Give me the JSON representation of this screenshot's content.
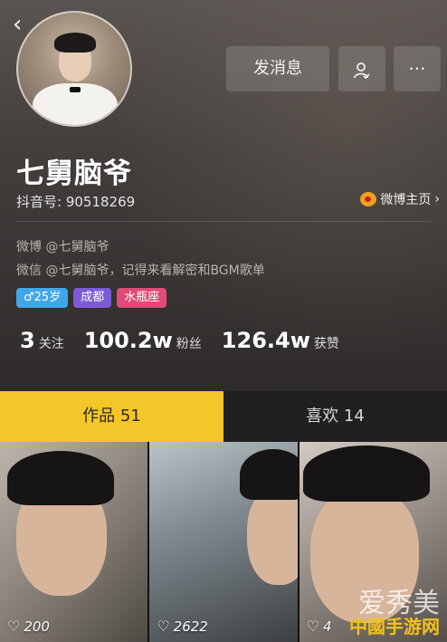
{
  "header": {
    "back_icon": "back-chevron-icon",
    "send_message_label": "发消息",
    "follow_icon": "user-check-icon",
    "more_icon": "more-dots-icon"
  },
  "profile": {
    "name": "七舅脑爷",
    "douyin_id": "抖音号: 90518269",
    "weibo_link": "微博主页",
    "bio": [
      "微博 @七舅脑爷",
      "微信 @七舅脑爷，记得来看解密和BGM歌单"
    ],
    "tags": [
      {
        "label": "♂25岁",
        "color": "#3fa7e8"
      },
      {
        "label": "成都",
        "color": "#7d5bd6"
      },
      {
        "label": "水瓶座",
        "color": "#e04b78"
      }
    ],
    "stats": [
      {
        "value": "3",
        "label": "关注"
      },
      {
        "value": "100.2w",
        "label": "粉丝"
      },
      {
        "value": "126.4w",
        "label": "获赞"
      }
    ]
  },
  "tabs": [
    {
      "label": "作品 51",
      "active": true
    },
    {
      "label": "喜欢 14",
      "active": false
    }
  ],
  "videos": [
    {
      "likes": "200"
    },
    {
      "likes": "2622"
    },
    {
      "likes": "4"
    }
  ],
  "watermark": {
    "line1": "爱秀美",
    "line2": "中國手游网"
  },
  "colors": {
    "tab_active": "#f5c629",
    "tab_inactive": "#221f22"
  }
}
